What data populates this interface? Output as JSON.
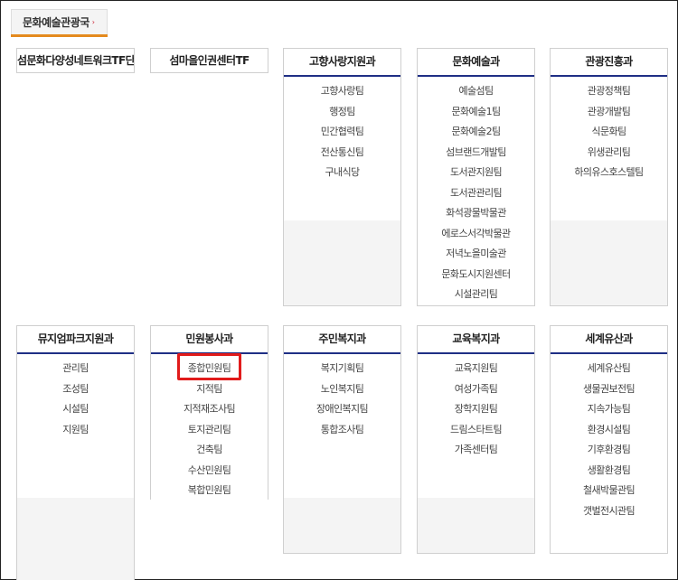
{
  "department": {
    "label": "문화예술관광국",
    "arrow": "›"
  },
  "teams": [
    {
      "title": "섬문화다양성네트워크TF단",
      "items": []
    },
    {
      "title": "섬마을인권센터TF",
      "items": []
    },
    {
      "title": "고향사랑지원과",
      "items": [
        "고향사랑팀",
        "행정팀",
        "민간협력팀",
        "전산통신팀",
        "구내식당"
      ]
    },
    {
      "title": "문화예술과",
      "items": [
        "예술섬팀",
        "문화예술1팀",
        "문화예술2팀",
        "섬브랜드개발팀",
        "도서관지원팀",
        "도서관관리팀",
        "화석광물박물관",
        "에로스서각박물관",
        "저녁노을미술관",
        "문화도시지원센터",
        "시설관리팀"
      ]
    },
    {
      "title": "관광진흥과",
      "items": [
        "관광정책팀",
        "관광개발팀",
        "식문화팀",
        "위생관리팀",
        "하의유스호스텔팀"
      ]
    },
    {
      "title": "뮤지엄파크지원과",
      "items": [
        "관리팀",
        "조성팀",
        "시설팀",
        "지원팀"
      ]
    },
    {
      "title": "민원봉사과",
      "items": [
        "종합민원팀",
        "지적팀",
        "지적재조사팀",
        "토지관리팀",
        "건축팀",
        "수산민원팀",
        "복합민원팀"
      ]
    },
    {
      "title": "주민복지과",
      "items": [
        "복지기획팀",
        "노인복지팀",
        "장애인복지팀",
        "통합조사팀"
      ]
    },
    {
      "title": "교육복지과",
      "items": [
        "교육지원팀",
        "여성가족팀",
        "장학지원팀",
        "드림스타트팀",
        "가족센터팀"
      ]
    },
    {
      "title": "세계유산과",
      "items": [
        "세계유산팀",
        "생물권보전팀",
        "지속가능팀",
        "환경시설팀",
        "기후환경팀",
        "생활환경팀",
        "철새박물관팀",
        "갯벌전시관팀"
      ]
    }
  ],
  "colors": {
    "header_rule": "#1f2f85",
    "tab_rule": "#e48a1e",
    "highlight": "#e11b1b"
  }
}
